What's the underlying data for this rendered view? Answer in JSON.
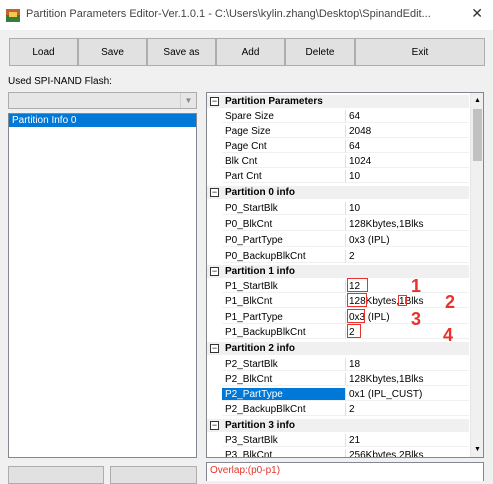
{
  "window": {
    "title": "Partition Parameters Editor-Ver.1.0.1 - C:\\Users\\kylin.zhang\\Desktop\\SpinandEdit...",
    "close_glyph": "✕"
  },
  "toolbar": {
    "load_label": "Load",
    "save_label": "Save",
    "save_as_label": "Save as",
    "add_label": "Add",
    "delete_label": "Delete",
    "exit_label": "Exit"
  },
  "left": {
    "used_label": "Used SPI-NAND Flash:",
    "combo_value": "",
    "list_items": [
      "Partition Info 0"
    ]
  },
  "grid": {
    "categories": {
      "params": "Partition Parameters",
      "p0": "Partition 0 info",
      "p1": "Partition 1 info",
      "p2": "Partition 2 info",
      "p3": "Partition 3 info"
    },
    "params": [
      {
        "name": "Spare Size",
        "value": "64"
      },
      {
        "name": "Page Size",
        "value": "2048"
      },
      {
        "name": "Page Cnt",
        "value": "64"
      },
      {
        "name": "Blk Cnt",
        "value": "1024"
      },
      {
        "name": "Part Cnt",
        "value": "10"
      }
    ],
    "p0": [
      {
        "name": "P0_StartBlk",
        "value": "10"
      },
      {
        "name": "P0_BlkCnt",
        "value": "128Kbytes,1Blks"
      },
      {
        "name": "P0_PartType",
        "value": "0x3 (IPL)"
      },
      {
        "name": "P0_BackupBlkCnt",
        "value": "2"
      }
    ],
    "p1": [
      {
        "name": "P1_StartBlk",
        "value": "12"
      },
      {
        "name": "P1_BlkCnt",
        "value": "128Kbytes,1Blks"
      },
      {
        "name": "P1_PartType",
        "value": "0x3 (IPL)"
      },
      {
        "name": "P1_BackupBlkCnt",
        "value": "2"
      }
    ],
    "p2": [
      {
        "name": "P2_StartBlk",
        "value": "18"
      },
      {
        "name": "P2_BlkCnt",
        "value": "128Kbytes,1Blks"
      },
      {
        "name": "P2_PartType",
        "value": "0x1 (IPL_CUST)"
      },
      {
        "name": "P2_BackupBlkCnt",
        "value": "2"
      }
    ],
    "p3": [
      {
        "name": "P3_StartBlk",
        "value": "21"
      },
      {
        "name": "P3_BlkCnt",
        "value": "256Kbytes,2Blks"
      }
    ]
  },
  "annotations": [
    "1",
    "2",
    "3",
    "4"
  ],
  "status_text": "Overlap:(p0-p1)",
  "colors": {
    "accent": "#0078d7",
    "annotation": "#e8322c"
  }
}
